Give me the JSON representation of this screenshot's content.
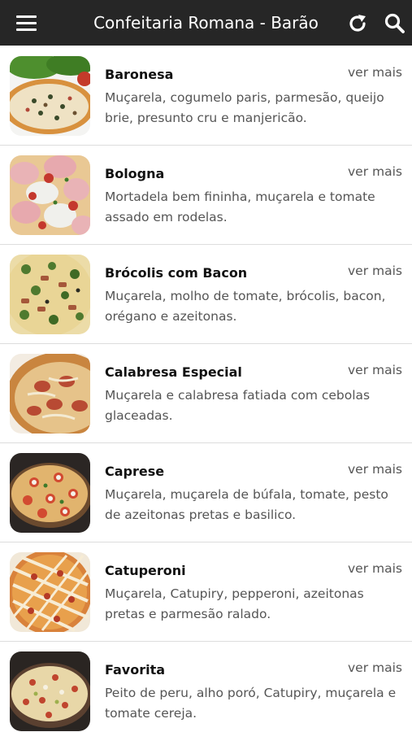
{
  "header": {
    "title": "Confeitaria Romana - Barão",
    "background": "#262626",
    "icons": {
      "menu": "hamburger-menu-icon",
      "refresh": "refresh-icon",
      "search": "search-icon"
    }
  },
  "products": [
    {
      "name": "Baronesa",
      "more": "ver mais",
      "description": "Muçarela, cogumelo paris, parmesão, queijo brie, presunto cru e manjericão."
    },
    {
      "name": "Bologna",
      "more": "ver mais",
      "description": "Mortadela bem fininha, muçarela e tomate assado em rodelas."
    },
    {
      "name": "Brócolis com Bacon",
      "more": "ver mais",
      "description": "Muçarela, molho de tomate, brócolis, bacon, orégano e azeitonas."
    },
    {
      "name": "Calabresa Especial",
      "more": "ver mais",
      "description": "Muçarela e calabresa fatiada com cebolas glaceadas."
    },
    {
      "name": "Caprese",
      "more": "ver mais",
      "description": "Muçarela, muçarela de búfala, tomate, pesto de azeitonas pretas e basilico."
    },
    {
      "name": "Catuperoni",
      "more": "ver mais",
      "description": "Muçarela, Catupiry, pepperoni, azeitonas pretas e parmesão ralado."
    },
    {
      "name": "Favorita",
      "more": "ver mais",
      "description": "Peito de peru, alho poró, Catupiry, muçarela e tomate cereja."
    }
  ]
}
